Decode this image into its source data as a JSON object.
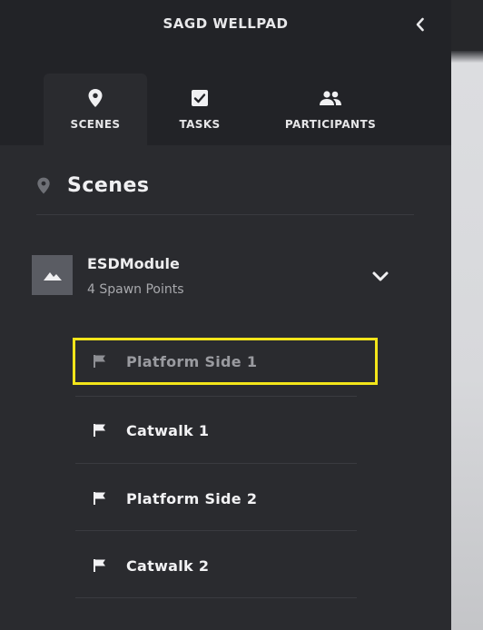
{
  "header": {
    "title": "SAGD WELLPAD",
    "collapse_icon": "chevron-left-icon"
  },
  "tabs": [
    {
      "label": "SCENES",
      "icon": "map-pin-icon",
      "active": true
    },
    {
      "label": "TASKS",
      "icon": "checkbox-icon",
      "active": false
    },
    {
      "label": "PARTICIPANTS",
      "icon": "people-icon",
      "active": false
    }
  ],
  "section": {
    "title": "Scenes",
    "icon": "map-pin-icon"
  },
  "module": {
    "name": "ESDModule",
    "subtitle": "4 Spawn Points",
    "thumbnail_icon": "landscape-image-icon",
    "expand_icon": "chevron-down-icon"
  },
  "spawn_points": [
    {
      "label": "Platform Side 1",
      "selected": true
    },
    {
      "label": "Catwalk 1",
      "selected": false
    },
    {
      "label": "Platform Side 2",
      "selected": false
    },
    {
      "label": "Catwalk 2",
      "selected": false
    }
  ],
  "colors": {
    "panel": "#2a2b2f",
    "header": "#222327",
    "selection_outline": "#f3e51a",
    "text": "#f0f0f2",
    "muted_text": "#a8a9ad"
  }
}
